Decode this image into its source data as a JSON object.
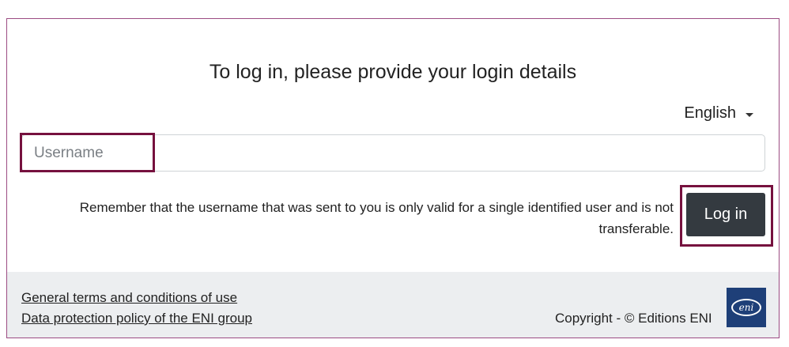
{
  "login": {
    "title": "To log in, please provide your login details",
    "language": {
      "selected": "English"
    },
    "username": {
      "placeholder": "Username",
      "value": ""
    },
    "notice": "Remember that the username that was sent to you is only valid for a single identified user and is not transferable.",
    "login_button_label": "Log in"
  },
  "footer": {
    "links": [
      "General terms and conditions of use",
      "Data protection policy of the ENI group"
    ],
    "copyright": "Copyright - © Editions ENI",
    "logo_text": "eni"
  },
  "colors": {
    "highlight": "#76113e",
    "frame_border": "#9c4b82",
    "button_bg": "#343a40",
    "footer_bg": "#eceef0",
    "logo_bg": "#1e3f78"
  }
}
